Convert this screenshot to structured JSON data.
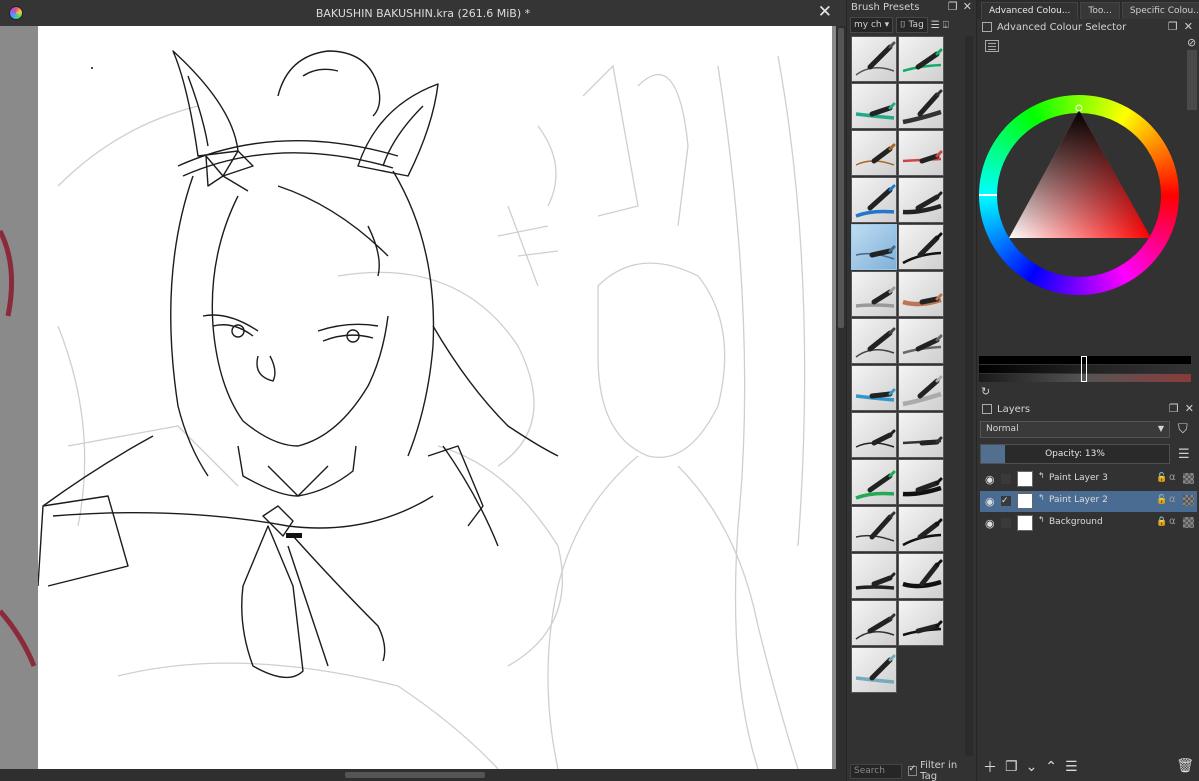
{
  "window": {
    "title": "BAKUSHIN BAKUSHIN.kra (261.6 MiB) *",
    "close_glyph": "✕",
    "app_icon": "krita-app-icon"
  },
  "brush_presets": {
    "title": "Brush Presets",
    "tag_combo": "my ch",
    "tag_button": "Tag",
    "search_placeholder": "Search",
    "filter_in_tag_label": "Filter in Tag",
    "filter_in_tag_checked": true,
    "selected_index": 8,
    "preset_count": 27
  },
  "right_dock": {
    "tabs": [
      "Advanced Colou...",
      "Too...",
      "Specific Colou..."
    ],
    "active_tab": 0,
    "advanced_colour_selector": {
      "title": "Advanced Colour Selector",
      "current_color": "#ffffff",
      "hue_color": "#ff0000"
    },
    "layers": {
      "title": "Layers",
      "blend_mode": "Normal",
      "opacity_label": "Opacity:  13%",
      "opacity_value": 13,
      "items": [
        {
          "name": "Paint Layer 3",
          "visible": true,
          "active": false,
          "locked": false
        },
        {
          "name": "Paint Layer 2",
          "visible": true,
          "active": true,
          "locked": false
        },
        {
          "name": "Background",
          "visible": true,
          "active": false,
          "locked": true
        }
      ]
    }
  },
  "colors": {
    "selection_blue": "#4a6c93",
    "opacity_fill": "#526f90",
    "panel_bg": "#323232"
  }
}
